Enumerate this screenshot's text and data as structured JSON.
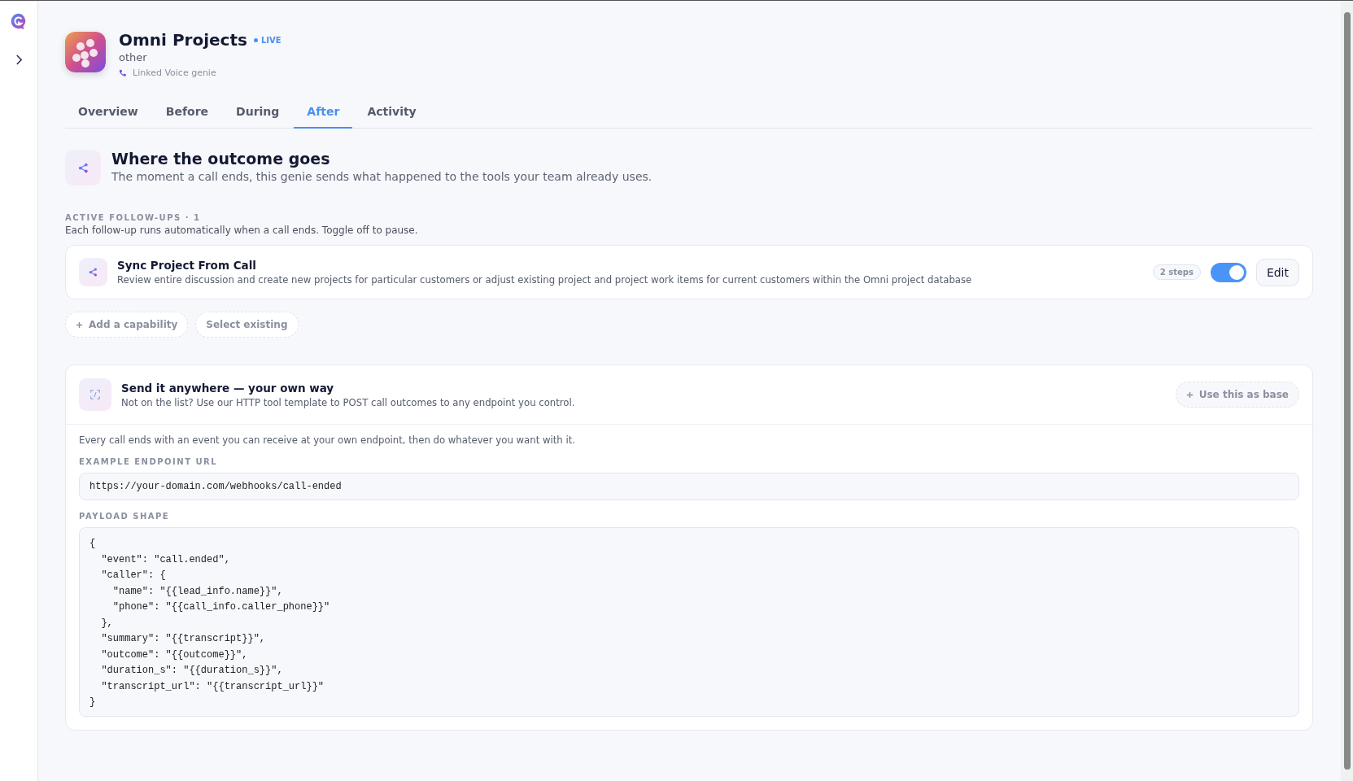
{
  "app": {
    "name": "Omni Projects",
    "status": "LIVE",
    "category": "other",
    "linked": "Linked Voice genie"
  },
  "tabs": [
    {
      "label": "Overview",
      "selected": false
    },
    {
      "label": "Before",
      "selected": false
    },
    {
      "label": "During",
      "selected": false
    },
    {
      "label": "After",
      "selected": true
    },
    {
      "label": "Activity",
      "selected": false
    }
  ],
  "section": {
    "title": "Where the outcome goes",
    "description": "The moment a call ends, this genie sends what happened to the tools your team already uses."
  },
  "follow_ups": {
    "heading": "ACTIVE FOLLOW-UPS · 1",
    "hint": "Each follow-up runs automatically when a call ends. Toggle off to pause.",
    "items": [
      {
        "title": "Sync Project From Call",
        "description": "Review entire discussion and create new projects for particular customers or adjust existing project and project work items for current customers within the Omni project database",
        "steps": "2 steps",
        "on": true,
        "edit": "Edit"
      }
    ],
    "actions": [
      "Add a capability",
      "Select existing"
    ]
  },
  "custom": {
    "title": "Send it anywhere — your own way",
    "description": "Not on the list? Use our HTTP tool template to POST call outcomes to any endpoint you control.",
    "button": "Use this as base",
    "intro": "Every call ends with an event you can receive at your own endpoint, then do whatever you want with it.",
    "url_label": "EXAMPLE ENDPOINT URL",
    "url": "https://your-domain.com/webhooks/call-ended",
    "payload_label": "PAYLOAD SHAPE",
    "payload": "{\n  \"event\": \"call.ended\",\n  \"caller\": {\n    \"name\": \"{{lead_info.name}}\",\n    \"phone\": \"{{call_info.caller_phone}}\"\n  },\n  \"summary\": \"{{transcript}}\",\n  \"outcome\": \"{{outcome}}\",\n  \"duration_s\": \"{{duration_s}}\",\n  \"transcript_url\": \"{{transcript_url}}\"\n}"
  }
}
